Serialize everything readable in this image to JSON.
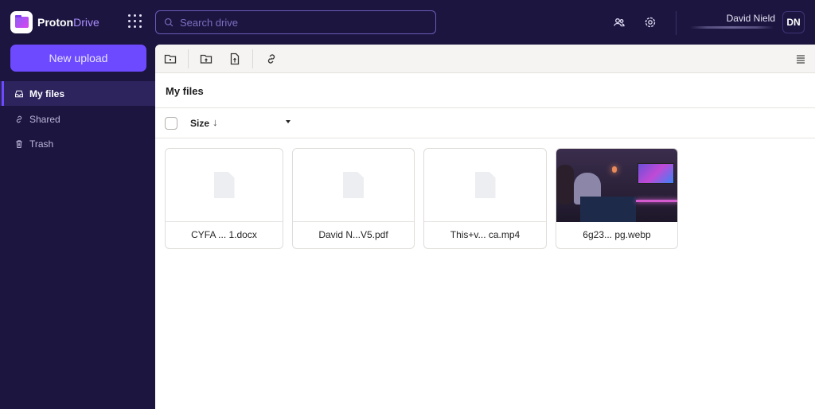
{
  "app": {
    "brand_main": "Proton",
    "brand_accent": "Drive",
    "accent_color": "#6d4aff"
  },
  "header": {
    "search_placeholder": "Search drive",
    "user_name": "David Nield",
    "avatar_initials": "DN"
  },
  "sidebar": {
    "new_upload_label": "New upload",
    "items": [
      {
        "label": "My files",
        "icon": "inbox-icon",
        "active": true
      },
      {
        "label": "Shared",
        "icon": "link-icon",
        "active": false
      },
      {
        "label": "Trash",
        "icon": "trash-icon",
        "active": false
      }
    ]
  },
  "toolbar": {
    "buttons": [
      "new-folder",
      "upload-folder",
      "upload-file",
      "get-link"
    ],
    "view_toggle": "list-view"
  },
  "main": {
    "title": "My files",
    "sort_label": "Size",
    "sort_direction": "descending",
    "files": [
      {
        "name": "CYFA ... 1.docx",
        "type": "document"
      },
      {
        "name": "David N...V5.pdf",
        "type": "document"
      },
      {
        "name": "This+v... ca.mp4",
        "type": "video"
      },
      {
        "name": "6g23... pg.webp",
        "type": "image"
      }
    ]
  }
}
